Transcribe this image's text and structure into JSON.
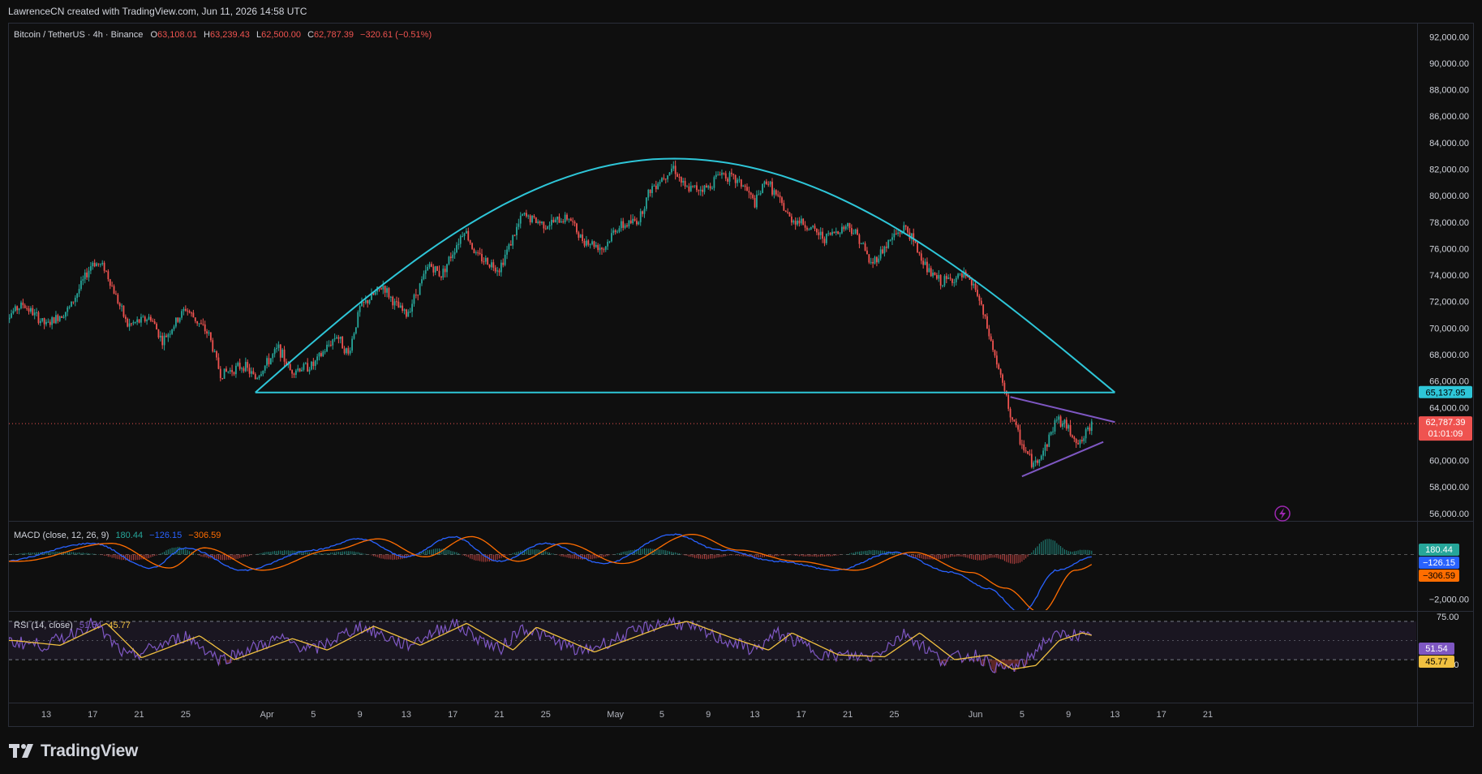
{
  "header": {
    "attribution": "LawrenceCN created with TradingView.com, Jun 11, 2026 14:58 UTC"
  },
  "legend": {
    "symbol": "Bitcoin / TetherUS · 4h · Binance",
    "open_label": "O",
    "open": "63,108.01",
    "high_label": "H",
    "high": "63,239.43",
    "low_label": "L",
    "low": "62,500.00",
    "close_label": "C",
    "close": "62,787.39",
    "change": "−320.61 (−0.51%)"
  },
  "macd_legend": {
    "name": "MACD (close, 12, 26, 9)",
    "hist": "180.44",
    "macd": "−126.15",
    "signal": "−306.59"
  },
  "rsi_legend": {
    "name": "RSI (14, close)",
    "rsi": "51.54",
    "ma": "45.77"
  },
  "badges": {
    "neckline": "65,137.95",
    "last_price": "62,787.39",
    "countdown": "01:01:09",
    "macd_hist": "180.44",
    "macd_line": "−126.15",
    "macd_signal": "−306.59",
    "rsi": "51.54",
    "rsi_ma": "45.77"
  },
  "colors": {
    "background": "#0f0f0f",
    "up": "#26a69a",
    "down": "#ef5350",
    "arc": "#2ec6d8",
    "triangle": "#7e57c2",
    "macd_line": "#2962ff",
    "signal_line": "#ff6d00",
    "rsi_line": "#7e57c2",
    "rsi_ma": "#f0c040"
  },
  "brand": {
    "name": "TradingView",
    "icon": "tradingview-logo-icon"
  },
  "misc": {
    "replay_icon": "lightning-icon"
  },
  "chart_data": [
    {
      "type": "candlestick",
      "title": "Bitcoin / TetherUS · 4h · Binance",
      "y_ticks": [
        "92,000.00",
        "90,000.00",
        "88,000.00",
        "86,000.00",
        "84,000.00",
        "82,000.00",
        "80,000.00",
        "78,000.00",
        "76,000.00",
        "74,000.00",
        "72,000.00",
        "70,000.00",
        "68,000.00",
        "66,000.00",
        "64,000.00",
        "62,000.00",
        "60,000.00",
        "58,000.00",
        "56,000.00"
      ],
      "x_ticks": [
        "13",
        "17",
        "21",
        "25",
        "Apr",
        "5",
        "9",
        "13",
        "17",
        "21",
        "25",
        "May",
        "5",
        "9",
        "13",
        "17",
        "21",
        "25",
        "Jun",
        "5",
        "9",
        "13",
        "17",
        "21"
      ],
      "ylim": [
        55500,
        93000
      ],
      "price_path": [
        {
          "d": "Mar 9",
          "p": 70500
        },
        {
          "d": "Mar 11",
          "p": 71800
        },
        {
          "d": "Mar 13",
          "p": 70200
        },
        {
          "d": "Mar 15",
          "p": 71500
        },
        {
          "d": "Mar 17",
          "p": 75000
        },
        {
          "d": "Mar 18",
          "p": 74600
        },
        {
          "d": "Mar 20",
          "p": 70200
        },
        {
          "d": "Mar 22",
          "p": 70800
        },
        {
          "d": "Mar 23",
          "p": 69000
        },
        {
          "d": "Mar 25",
          "p": 71500
        },
        {
          "d": "Mar 27",
          "p": 69500
        },
        {
          "d": "Mar 28",
          "p": 66500
        },
        {
          "d": "Mar 30",
          "p": 67200
        },
        {
          "d": "Mar 31",
          "p": 66200
        },
        {
          "d": "Apr 2",
          "p": 68500
        },
        {
          "d": "Apr 3",
          "p": 66800
        },
        {
          "d": "Apr 5",
          "p": 67200
        },
        {
          "d": "Apr 7",
          "p": 69500
        },
        {
          "d": "Apr 8",
          "p": 68000
        },
        {
          "d": "Apr 9",
          "p": 71500
        },
        {
          "d": "Apr 11",
          "p": 73200
        },
        {
          "d": "Apr 12",
          "p": 71800
        },
        {
          "d": "Apr 13",
          "p": 71000
        },
        {
          "d": "Apr 15",
          "p": 74800
        },
        {
          "d": "Apr 16",
          "p": 74000
        },
        {
          "d": "Apr 18",
          "p": 77500
        },
        {
          "d": "Apr 19",
          "p": 75500
        },
        {
          "d": "Apr 21",
          "p": 74500
        },
        {
          "d": "Apr 22",
          "p": 76500
        },
        {
          "d": "Apr 23",
          "p": 78500
        },
        {
          "d": "Apr 25",
          "p": 77800
        },
        {
          "d": "Apr 27",
          "p": 78400
        },
        {
          "d": "Apr 28",
          "p": 76800
        },
        {
          "d": "Apr 30",
          "p": 76000
        },
        {
          "d": "May 1",
          "p": 77500
        },
        {
          "d": "May 3",
          "p": 78200
        },
        {
          "d": "May 4",
          "p": 80500
        },
        {
          "d": "May 6",
          "p": 82200
        },
        {
          "d": "May 7",
          "p": 80500
        },
        {
          "d": "May 9",
          "p": 80600
        },
        {
          "d": "May 10",
          "p": 81800
        },
        {
          "d": "May 12",
          "p": 80800
        },
        {
          "d": "May 13",
          "p": 79400
        },
        {
          "d": "May 14",
          "p": 81200
        },
        {
          "d": "May 16",
          "p": 78300
        },
        {
          "d": "May 17",
          "p": 78000
        },
        {
          "d": "May 19",
          "p": 76800
        },
        {
          "d": "May 21",
          "p": 77800
        },
        {
          "d": "May 22",
          "p": 76800
        },
        {
          "d": "May 23",
          "p": 74800
        },
        {
          "d": "May 25",
          "p": 77000
        },
        {
          "d": "May 26",
          "p": 77600
        },
        {
          "d": "May 28",
          "p": 74200
        },
        {
          "d": "May 29",
          "p": 73500
        },
        {
          "d": "May 31",
          "p": 73900
        },
        {
          "d": "Jun 1",
          "p": 73000
        },
        {
          "d": "Jun 2",
          "p": 70000
        },
        {
          "d": "Jun 3",
          "p": 66800
        },
        {
          "d": "Jun 4",
          "p": 63500
        },
        {
          "d": "Jun 5",
          "p": 61200
        },
        {
          "d": "Jun 6",
          "p": 59600
        },
        {
          "d": "Jun 7",
          "p": 61000
        },
        {
          "d": "Jun 8",
          "p": 63200
        },
        {
          "d": "Jun 9",
          "p": 62400
        },
        {
          "d": "Jun 10",
          "p": 61200
        },
        {
          "d": "Jun 11",
          "p": 62787
        }
      ],
      "rounded_top_arc": {
        "from": {
          "d": "Mar 31",
          "p": 65137.95
        },
        "apex": {
          "d": "May 6",
          "p": 82800
        },
        "to": {
          "d": "Jun 13",
          "p": 65137.95
        }
      },
      "neckline": {
        "from": {
          "d": "Mar 31",
          "p": 65137.95
        },
        "to": {
          "d": "Jun 13",
          "p": 65137.95
        }
      },
      "triangle": {
        "upper": [
          {
            "d": "Jun 4",
            "p": 64800
          },
          {
            "d": "Jun 13",
            "p": 62900
          }
        ],
        "lower": [
          {
            "d": "Jun 5",
            "p": 58800
          },
          {
            "d": "Jun 12",
            "p": 61400
          }
        ]
      },
      "last_price": 62787.39
    },
    {
      "type": "line",
      "title": "MACD (close, 12, 26, 9)",
      "y_ticks": [
        "−2,000.00"
      ],
      "series": [
        {
          "name": "MACD",
          "values_at_end": -126.15
        },
        {
          "name": "Signal",
          "values_at_end": -306.59
        },
        {
          "name": "Histogram",
          "values_at_end": 180.44
        }
      ],
      "path": [
        {
          "d": "Mar 9",
          "macd": -300
        },
        {
          "d": "Mar 17",
          "macd": 500
        },
        {
          "d": "Mar 22",
          "macd": -600
        },
        {
          "d": "Mar 25",
          "macd": 300
        },
        {
          "d": "Mar 30",
          "macd": -700
        },
        {
          "d": "Apr 5",
          "macd": 200
        },
        {
          "d": "Apr 9",
          "macd": 700
        },
        {
          "d": "Apr 13",
          "macd": -100
        },
        {
          "d": "Apr 17",
          "macd": 800
        },
        {
          "d": "Apr 21",
          "macd": -300
        },
        {
          "d": "Apr 25",
          "macd": 500
        },
        {
          "d": "Apr 30",
          "macd": -400
        },
        {
          "d": "May 6",
          "macd": 900
        },
        {
          "d": "May 10",
          "macd": 200
        },
        {
          "d": "May 15",
          "macd": -300
        },
        {
          "d": "May 20",
          "macd": -700
        },
        {
          "d": "May 25",
          "macd": 100
        },
        {
          "d": "May 30",
          "macd": -800
        },
        {
          "d": "Jun 2",
          "macd": -1500
        },
        {
          "d": "Jun 5",
          "macd": -2600
        },
        {
          "d": "Jun 8",
          "macd": -700
        },
        {
          "d": "Jun 11",
          "macd": -126
        }
      ]
    },
    {
      "type": "line",
      "title": "RSI (14, close)",
      "y_ticks": [
        "75.00",
        "25.00"
      ],
      "series": [
        {
          "name": "RSI",
          "values_at_end": 51.54
        },
        {
          "name": "RSI MA",
          "values_at_end": 45.77
        }
      ],
      "path": [
        {
          "d": "Mar 9",
          "rsi": 50
        },
        {
          "d": "Mar 13",
          "rsi": 45
        },
        {
          "d": "Mar 17",
          "rsi": 68
        },
        {
          "d": "Mar 20",
          "rsi": 32
        },
        {
          "d": "Mar 25",
          "rsi": 55
        },
        {
          "d": "Mar 28",
          "rsi": 30
        },
        {
          "d": "Apr 2",
          "rsi": 52
        },
        {
          "d": "Apr 5",
          "rsi": 40
        },
        {
          "d": "Apr 9",
          "rsi": 65
        },
        {
          "d": "Apr 13",
          "rsi": 45
        },
        {
          "d": "Apr 17",
          "rsi": 68
        },
        {
          "d": "Apr 21",
          "rsi": 40
        },
        {
          "d": "Apr 23",
          "rsi": 64
        },
        {
          "d": "Apr 28",
          "rsi": 38
        },
        {
          "d": "May 4",
          "rsi": 65
        },
        {
          "d": "May 6",
          "rsi": 70
        },
        {
          "d": "May 10",
          "rsi": 52
        },
        {
          "d": "May 13",
          "rsi": 40
        },
        {
          "d": "May 15",
          "rsi": 58
        },
        {
          "d": "May 19",
          "rsi": 35
        },
        {
          "d": "May 23",
          "rsi": 33
        },
        {
          "d": "May 26",
          "rsi": 58
        },
        {
          "d": "May 29",
          "rsi": 30
        },
        {
          "d": "Jun 1",
          "rsi": 35
        },
        {
          "d": "Jun 3",
          "rsi": 20
        },
        {
          "d": "Jun 5",
          "rsi": 24
        },
        {
          "d": "Jun 7",
          "rsi": 50
        },
        {
          "d": "Jun 9",
          "rsi": 58
        },
        {
          "d": "Jun 11",
          "rsi": 51.54
        }
      ],
      "band": [
        30,
        70
      ]
    }
  ]
}
